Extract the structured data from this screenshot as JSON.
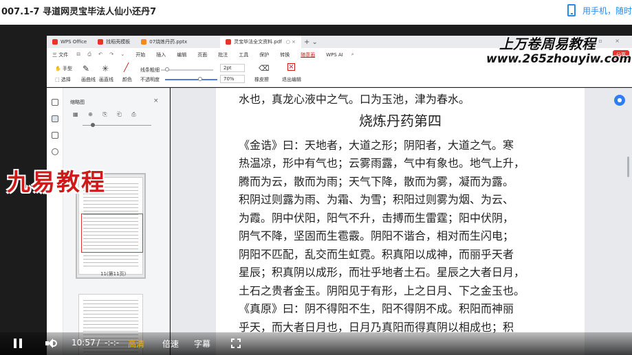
{
  "page": {
    "title": "007.1-7 寻道网灵宝毕法人仙小还丹7",
    "mobile_link": "用手机，随时"
  },
  "wps": {
    "tabs": [
      {
        "label": "WPS Office",
        "color": "#e8352c"
      },
      {
        "label": "找稻壳模板",
        "color": "#e8352c"
      },
      {
        "label": "07烧炼丹药.pptx",
        "color": "#f08a24"
      },
      {
        "label": "灵宝毕法全文资料.pdf",
        "color": "#e8352c"
      }
    ],
    "menu": [
      "三 文件",
      "开始",
      "插入",
      "编辑",
      "页面",
      "批注",
      "工具",
      "保护",
      "转换",
      "随意画",
      "WPS AI"
    ],
    "menu_active": "随意画",
    "share_label": "分享",
    "toolbar": {
      "hand": "手型",
      "select": "选择",
      "draw_line": "画曲线",
      "draw_straight": "画直线",
      "color": "颜色",
      "opacity": "不透明度",
      "line_width_label": "线条粗细",
      "line_width_value": "2pt",
      "opacity_value": "70%",
      "eraser": "橡皮擦",
      "exit": "退出编辑"
    },
    "thumbnails": {
      "title": "缩略图",
      "page_label": "11(第11页)"
    }
  },
  "document": {
    "lines": [
      "水也，真龙心液中之气。口为玉池，津为春水。",
      "烧炼丹药第四",
      "《金诰》曰：天地者，大道之形；阴阳者，大道之气。寒",
      "热温凉，形中有气也；云雾雨露，气中有象也。地气上升，",
      "腾而为云，散而为雨；天气下降，散而为雾，凝而为露。",
      "积阴过则露为雨、为霜、为雪；积阳过则雾为烟、为云、",
      "为霞。阴中伏阳，阳气不升，击搏而生雷霆；阳中伏阴，",
      "阴气不降，坚固而生雹霰。阴阳不谐合，相对而生闪电；",
      "阴阳不匹配，乱交而生虹霓。积真阳以成神，而丽乎天者",
      "星辰；积真阴以成形，而壮乎地者土石。星辰之大者日月，",
      "土石之贵者金玉。阴阳见于有形，上之日月、下之金玉也。",
      "《真原》曰：阴不得阳不生，阳不得阴不成。积阳而神丽",
      "乎天，而大者日月也，日月乃真阳而得真阴以相成也；积"
    ]
  },
  "watermarks": {
    "top_line1": "上万卷周易教程",
    "top_line2": "www.265zhouyiw.com",
    "left": "九易教程"
  },
  "player": {
    "time_current": "10:57",
    "time_sep": "/",
    "time_total": "-:-:-",
    "quality": "高清",
    "speed": "倍速",
    "subtitle": "字幕"
  }
}
